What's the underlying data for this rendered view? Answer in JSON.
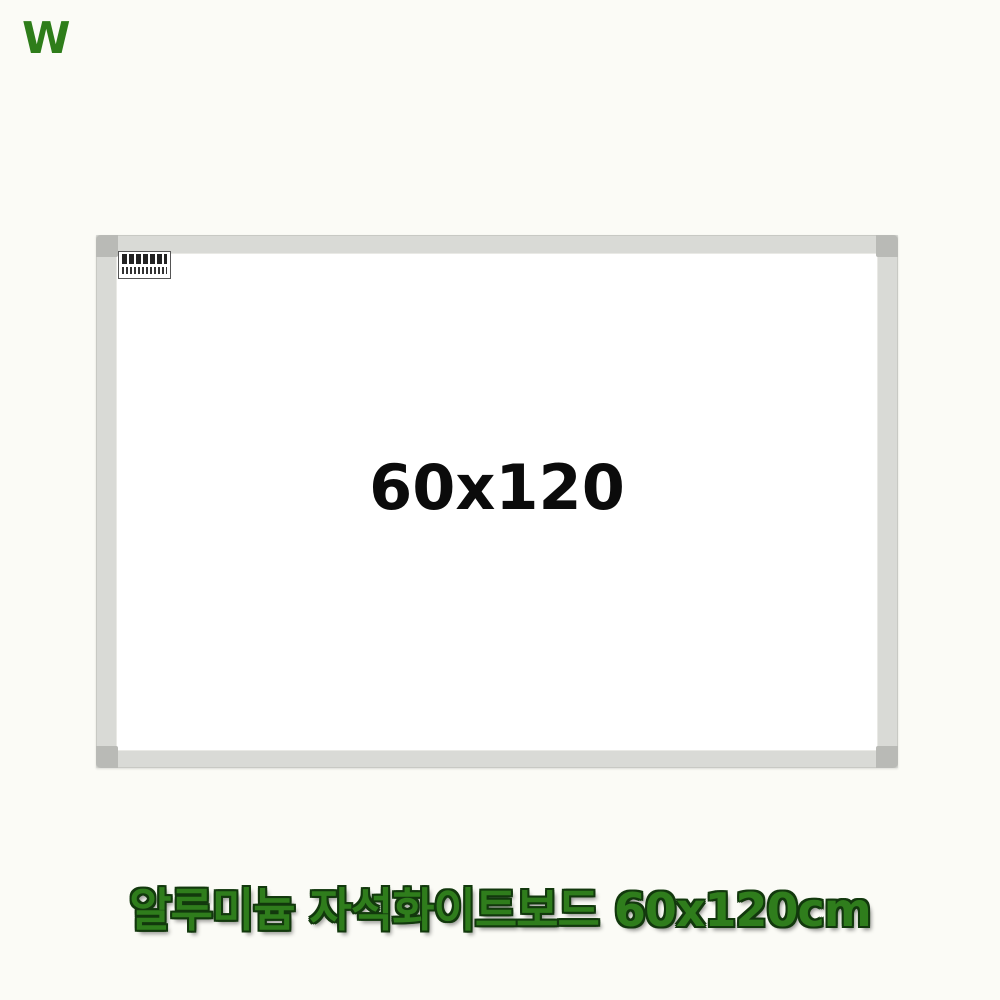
{
  "brand": {
    "logo_text": "W",
    "color": "#2e7d1a"
  },
  "board": {
    "size_label": "60x120",
    "sticker_label": "manufacturer-sticker"
  },
  "product": {
    "title": "알루미늄 자석화이트보드 60x120cm",
    "title_color": "#2f7d1c"
  }
}
